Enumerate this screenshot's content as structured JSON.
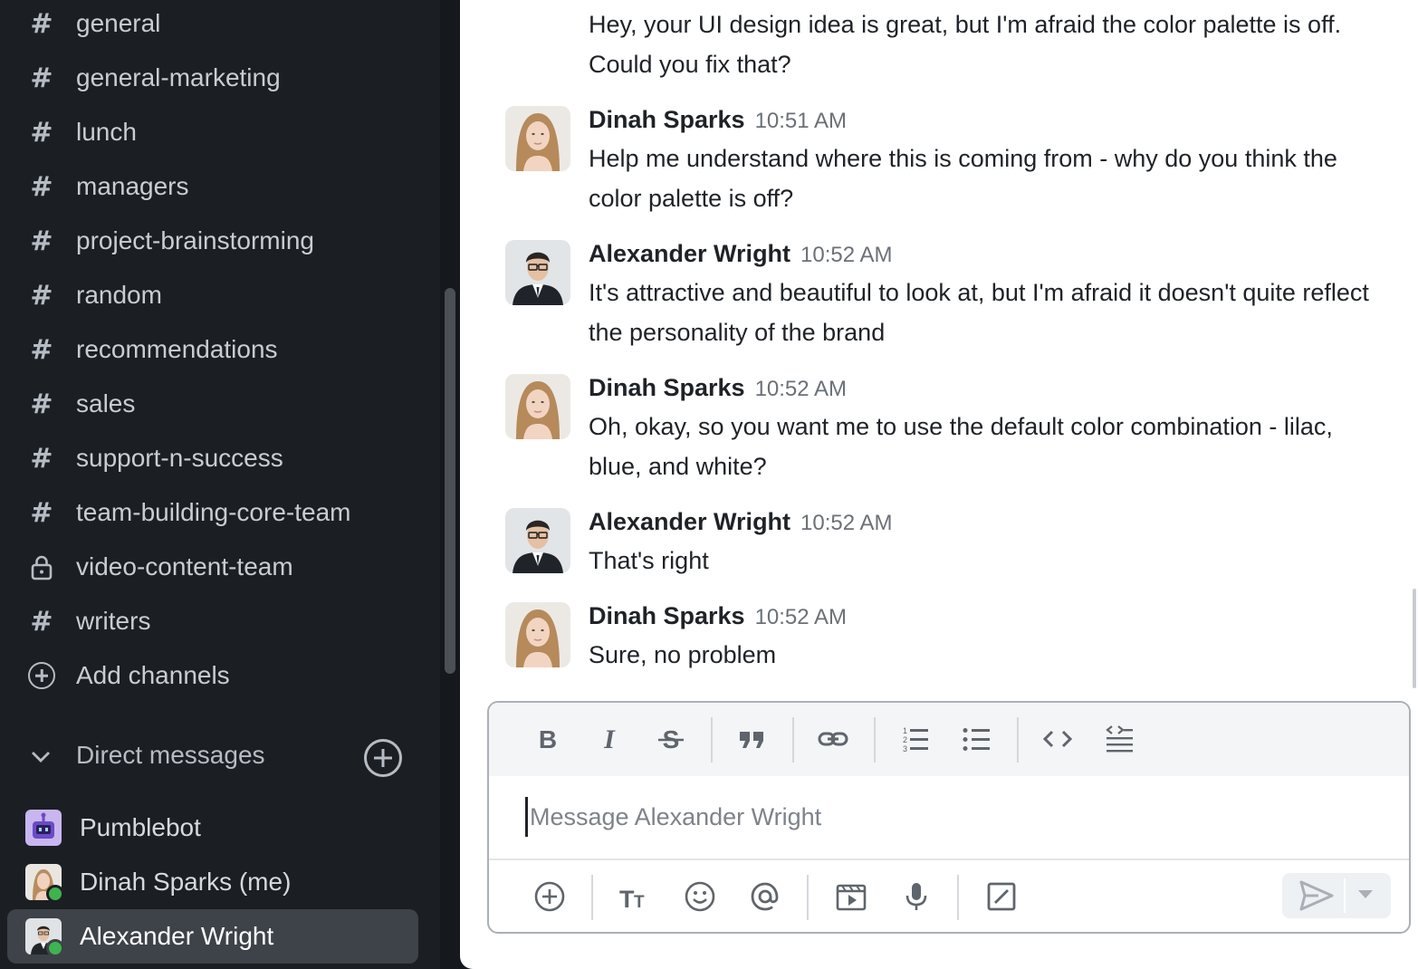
{
  "sidebar": {
    "channels": [
      {
        "label": "general",
        "icon": "hash-icon"
      },
      {
        "label": "general-marketing",
        "icon": "hash-icon"
      },
      {
        "label": "lunch",
        "icon": "hash-icon"
      },
      {
        "label": "managers",
        "icon": "hash-icon"
      },
      {
        "label": "project-brainstorming",
        "icon": "hash-icon"
      },
      {
        "label": "random",
        "icon": "hash-icon"
      },
      {
        "label": "recommendations",
        "icon": "hash-icon"
      },
      {
        "label": "sales",
        "icon": "hash-icon"
      },
      {
        "label": "support-n-success",
        "icon": "hash-icon"
      },
      {
        "label": "team-building-core-team",
        "icon": "hash-icon"
      },
      {
        "label": "video-content-team",
        "icon": "lock-icon"
      },
      {
        "label": "writers",
        "icon": "hash-icon"
      }
    ],
    "hash_glyph": "#",
    "add_channels_label": "Add channels",
    "dm_header_label": "Direct messages",
    "dms": [
      {
        "label": "Pumblebot",
        "avatar": "bot-avatar"
      },
      {
        "label": "Dinah Sparks (me)",
        "avatar": "woman-avatar",
        "online": true
      },
      {
        "label": "Alexander Wright",
        "avatar": "man-avatar",
        "online": true,
        "active": true
      }
    ]
  },
  "messages": {
    "continued_text": "Hey, your UI design idea is great, but I'm afraid the color palette is off. Could you fix that?",
    "items": [
      {
        "author": "Dinah Sparks",
        "time": "10:51 AM",
        "text": "Help me understand where this is coming from - why do you think the color palette is off?"
      },
      {
        "author": "Alexander Wright",
        "time": "10:52 AM",
        "text": "It's attractive and beautiful to look at, but I'm afraid it doesn't quite reflect the personality of the brand"
      },
      {
        "author": "Dinah Sparks",
        "time": "10:52 AM",
        "text": "Oh, okay, so you want me to use the default color combination - lilac, blue, and white?"
      },
      {
        "author": "Alexander Wright",
        "time": "10:52 AM",
        "text": "That's right"
      },
      {
        "author": "Dinah Sparks",
        "time": "10:52 AM",
        "text": "Sure, no problem"
      }
    ]
  },
  "composer": {
    "placeholder": "Message Alexander Wright",
    "value": "",
    "format_tools": [
      "bold-icon",
      "italic-icon",
      "strikethrough-icon",
      "quote-icon",
      "link-icon",
      "ordered-list-icon",
      "bullet-list-icon",
      "code-icon",
      "code-block-icon"
    ],
    "bottom_tools": [
      "attach-plus-icon",
      "text-format-icon",
      "emoji-icon",
      "mention-icon",
      "video-clip-icon",
      "microphone-icon",
      "slash-command-icon"
    ],
    "send_icon": "send-icon"
  },
  "colors": {
    "sidebar_bg": "#1b1f24",
    "active_dm_bg": "#3e4349",
    "online_status": "#3fb34f",
    "main_bg": "#ffffff"
  }
}
